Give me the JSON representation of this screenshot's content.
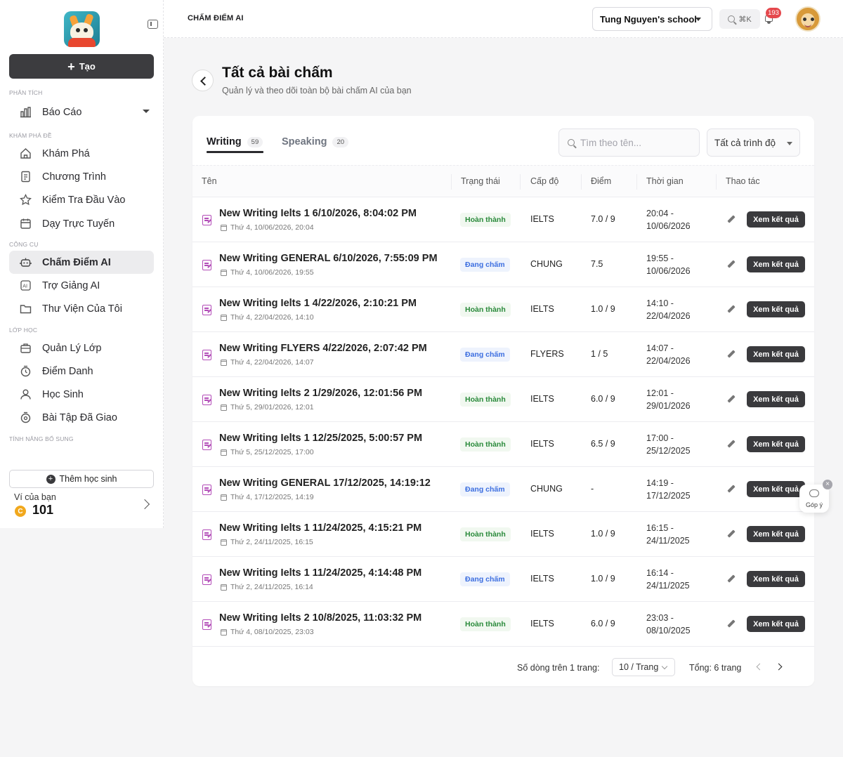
{
  "header": {
    "page_heading": "CHẤM ĐIỂM AI",
    "school": "Tung Nguyen's school",
    "search_shortcut": "⌘K",
    "notification_count": "193"
  },
  "sidebar": {
    "create_label": "Tạo",
    "sections": {
      "analytics": "PHÂN TÍCH",
      "explore": "KHÁM PHÁ ĐỀ",
      "tools": "CÔNG CỤ",
      "classes": "LỚP HỌC",
      "extras": "TÍNH NĂNG BỔ SUNG"
    },
    "items": {
      "report": "Báo Cáo",
      "discover": "Khám Phá",
      "program": "Chương Trình",
      "entry_test": "Kiểm Tra Đầu Vào",
      "online": "Dạy Trực Tuyến",
      "ai_grading": "Chấm Điểm AI",
      "ai_assistant": "Trợ Giảng AI",
      "library": "Thư Viện Của Tôi",
      "class_manage": "Quản Lý Lớp",
      "attendance": "Điểm Danh",
      "students": "Học Sinh",
      "assigned": "Bài Tập Đã Giao"
    },
    "add_student": "Thêm học sinh",
    "wallet_label": "Ví của bạn",
    "wallet_coin_symbol": "C",
    "wallet_value": "101"
  },
  "main": {
    "title": "Tất cả bài chấm",
    "subtitle": "Quản lý và theo dõi toàn bộ bài chấm AI của bạn",
    "tabs": [
      {
        "label": "Writing",
        "count": "59"
      },
      {
        "label": "Speaking",
        "count": "20"
      }
    ],
    "search_placeholder": "Tìm theo tên...",
    "level_filter": "Tất cả trình độ",
    "columns": {
      "name": "Tên",
      "status": "Trạng thái",
      "level": "Cấp độ",
      "score": "Điểm",
      "time": "Thời gian",
      "actions": "Thao tác"
    },
    "view_label": "Xem kết quả",
    "rows": [
      {
        "name": "New Writing Ielts 1 6/10/2026, 8:04:02 PM",
        "date": "Thứ 4, 10/06/2026, 20:04",
        "status": "Hoàn thành",
        "status_type": "done",
        "level": "IELTS",
        "score": "7.0 / 9",
        "time1": "20:04 -",
        "time2": "10/06/2026"
      },
      {
        "name": "New Writing GENERAL 6/10/2026, 7:55:09 PM",
        "date": "Thứ 4, 10/06/2026, 19:55",
        "status": "Đang chấm",
        "status_type": "grading",
        "level": "CHUNG",
        "score": "7.5",
        "time1": "19:55 -",
        "time2": "10/06/2026"
      },
      {
        "name": "New Writing Ielts 1 4/22/2026, 2:10:21 PM",
        "date": "Thứ 4, 22/04/2026, 14:10",
        "status": "Hoàn thành",
        "status_type": "done",
        "level": "IELTS",
        "score": "1.0 / 9",
        "time1": "14:10 -",
        "time2": "22/04/2026"
      },
      {
        "name": "New Writing FLYERS 4/22/2026, 2:07:42 PM",
        "date": "Thứ 4, 22/04/2026, 14:07",
        "status": "Đang chấm",
        "status_type": "grading",
        "level": "FLYERS",
        "score": "1 / 5",
        "time1": "14:07 -",
        "time2": "22/04/2026"
      },
      {
        "name": "New Writing Ielts 2 1/29/2026, 12:01:56 PM",
        "date": "Thứ 5, 29/01/2026, 12:01",
        "status": "Hoàn thành",
        "status_type": "done",
        "level": "IELTS",
        "score": "6.0 / 9",
        "time1": "12:01 -",
        "time2": "29/01/2026"
      },
      {
        "name": "New Writing Ielts 1 12/25/2025, 5:00:57 PM",
        "date": "Thứ 5, 25/12/2025, 17:00",
        "status": "Hoàn thành",
        "status_type": "done",
        "level": "IELTS",
        "score": "6.5 / 9",
        "time1": "17:00 -",
        "time2": "25/12/2025"
      },
      {
        "name": "New Writing GENERAL 17/12/2025, 14:19:12",
        "date": "Thứ 4, 17/12/2025, 14:19",
        "status": "Đang chấm",
        "status_type": "grading",
        "level": "CHUNG",
        "score": "-",
        "time1": "14:19 -",
        "time2": "17/12/2025"
      },
      {
        "name": "New Writing Ielts 1 11/24/2025, 4:15:21 PM",
        "date": "Thứ 2, 24/11/2025, 16:15",
        "status": "Hoàn thành",
        "status_type": "done",
        "level": "IELTS",
        "score": "1.0 / 9",
        "time1": "16:15 -",
        "time2": "24/11/2025"
      },
      {
        "name": "New Writing Ielts 1 11/24/2025, 4:14:48 PM",
        "date": "Thứ 2, 24/11/2025, 16:14",
        "status": "Đang chấm",
        "status_type": "grading",
        "level": "IELTS",
        "score": "1.0 / 9",
        "time1": "16:14 -",
        "time2": "24/11/2025"
      },
      {
        "name": "New Writing Ielts 2 10/8/2025, 11:03:32 PM",
        "date": "Thứ 4, 08/10/2025, 23:03",
        "status": "Hoàn thành",
        "status_type": "done",
        "level": "IELTS",
        "score": "6.0 / 9",
        "time1": "23:03 -",
        "time2": "08/10/2025"
      }
    ],
    "pager": {
      "rows_label": "Số dòng trên 1 trang:",
      "page_size": "10 / Trang",
      "total": "Tổng: 6 trang"
    }
  },
  "feedback": {
    "label": "Góp ý",
    "close_symbol": "×"
  }
}
